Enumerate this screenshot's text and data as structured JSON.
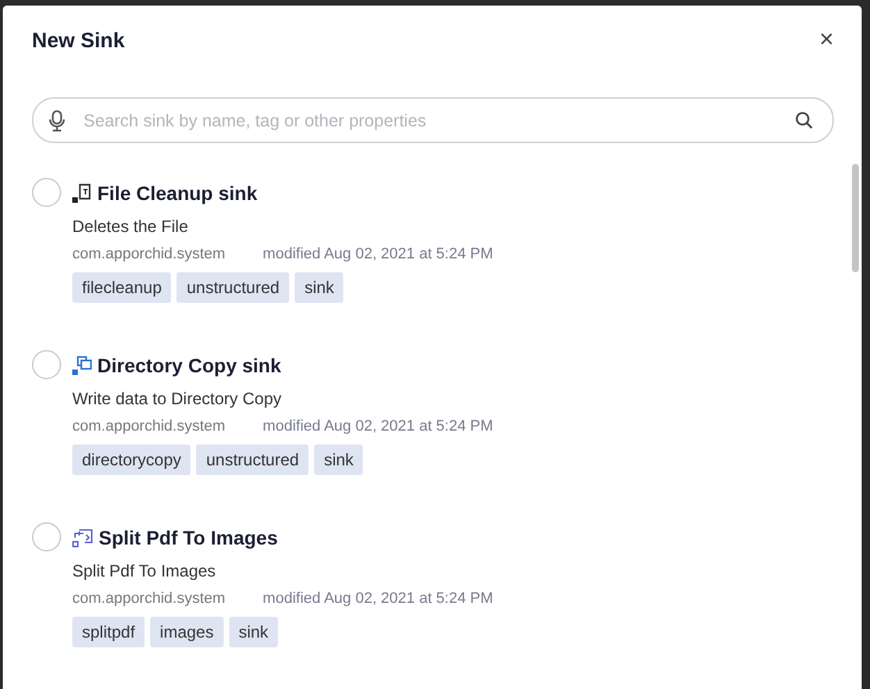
{
  "dialog": {
    "title": "New Sink",
    "close": "×"
  },
  "search": {
    "placeholder": "Search sink by name, tag or other properties"
  },
  "sinks": [
    {
      "kind": "file",
      "selected": false,
      "name": "File Cleanup sink",
      "description": "Deletes the File",
      "namespace": "com.apporchid.system",
      "modified": "modified Aug 02, 2021 at 5:24 PM",
      "tags": [
        "filecleanup",
        "unstructured",
        "sink"
      ]
    },
    {
      "kind": "copy",
      "selected": false,
      "name": "Directory Copy sink",
      "description": "Write data to Directory Copy",
      "namespace": "com.apporchid.system",
      "modified": "modified Aug 02, 2021 at 5:24 PM",
      "tags": [
        "directorycopy",
        "unstructured",
        "sink"
      ]
    },
    {
      "kind": "split",
      "selected": false,
      "name": "Split Pdf To Images",
      "description": "Split Pdf To Images",
      "namespace": "com.apporchid.system",
      "modified": "modified Aug 02, 2021 at 5:24 PM",
      "tags": [
        "splitpdf",
        "images",
        "sink"
      ]
    }
  ]
}
